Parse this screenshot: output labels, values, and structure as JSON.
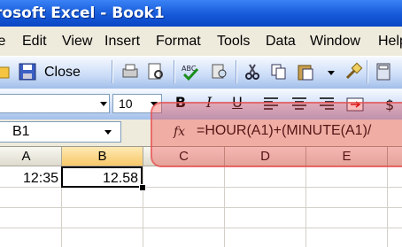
{
  "window": {
    "title": "rosoft Excel - Book1"
  },
  "menu": [
    "le",
    "Edit",
    "View",
    "Insert",
    "Format",
    "Tools",
    "Data",
    "Window",
    "Help"
  ],
  "toolbar": {
    "close_label": "Close",
    "font_size": "10",
    "name_box": "B1",
    "formula": "=HOUR(A1)+(MINUTE(A1)/"
  },
  "format_buttons": {
    "bold": "B",
    "italic": "I",
    "underline": "U"
  },
  "columns": [
    "A",
    "B",
    "C",
    "D",
    "E"
  ],
  "cells": {
    "a1": "12:35",
    "b1": "12.58"
  },
  "icons": [
    "save-icon",
    "print-icon",
    "print-preview-icon",
    "spelling-icon",
    "cut-icon",
    "copy-icon",
    "paste-icon",
    "format-painter-icon",
    "calculator-icon"
  ]
}
